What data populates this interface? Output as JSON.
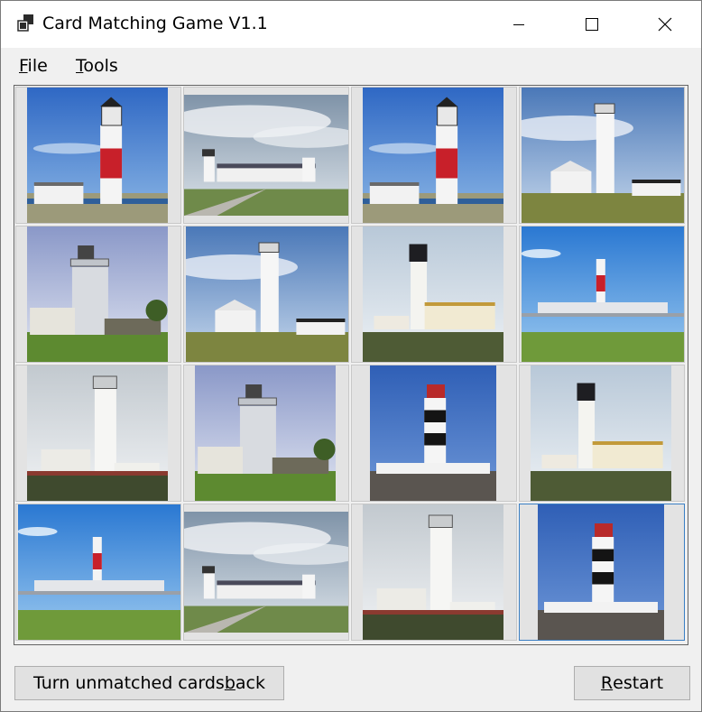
{
  "window": {
    "title": "Card Matching Game V1.1",
    "icons": {
      "app": "app-window-icon",
      "minimize": "minimize-icon",
      "maximize": "maximize-icon",
      "close": "close-icon"
    }
  },
  "menu": {
    "items": [
      {
        "label": "File",
        "mnemonic": "F"
      },
      {
        "label": "Tools",
        "mnemonic": "T"
      }
    ]
  },
  "board": {
    "rows": 4,
    "cols": 4,
    "selected_card": 15,
    "cards": [
      {
        "image": "lighthouse-red-band"
      },
      {
        "image": "lighthouse-coastal-cottages"
      },
      {
        "image": "lighthouse-red-band"
      },
      {
        "image": "lighthouse-white-tall-cottage"
      },
      {
        "image": "lighthouse-stone-tower"
      },
      {
        "image": "lighthouse-white-tall-cottage"
      },
      {
        "image": "lighthouse-black-lantern-yellow-house"
      },
      {
        "image": "lighthouse-red-stripe-distant"
      },
      {
        "image": "lighthouse-white-cloudy"
      },
      {
        "image": "lighthouse-stone-tower"
      },
      {
        "image": "lighthouse-black-white-stripes"
      },
      {
        "image": "lighthouse-black-lantern-yellow-house"
      },
      {
        "image": "lighthouse-red-stripe-distant"
      },
      {
        "image": "lighthouse-coastal-cottages"
      },
      {
        "image": "lighthouse-white-cloudy"
      },
      {
        "image": "lighthouse-black-white-stripes"
      }
    ]
  },
  "buttons": {
    "turn_back": {
      "label": "Turn unmatched cards back",
      "mnemonic": "b"
    },
    "restart": {
      "label": "Restart",
      "mnemonic": "R"
    }
  }
}
